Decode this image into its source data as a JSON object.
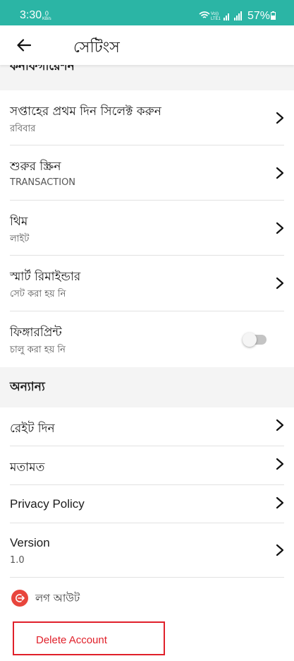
{
  "status_bar": {
    "time": "3:30",
    "data_rate_value": "0",
    "data_rate_unit": "KB/s",
    "network_label": "VoLTE1",
    "battery": "57%"
  },
  "app_bar": {
    "back_icon": "arrow-left-icon",
    "title": "সেটিংস"
  },
  "sections": {
    "config_title": "কনফিগারেশন",
    "other_title": "অন্যান্য"
  },
  "settings": {
    "week_start": {
      "title": "সপ্তাহের প্রথম দিন সিলেক্ট করুন",
      "value": "রবিবার"
    },
    "start_screen": {
      "title": "শুরুর স্ক্রিন",
      "value": "TRANSACTION"
    },
    "theme": {
      "title": "থিম",
      "value": "লাইট"
    },
    "smart_reminder": {
      "title": "স্মার্ট রিমাইন্ডার",
      "value": "সেট করা হয় নি"
    },
    "fingerprint": {
      "title": "ফিঙ্গারপ্রিন্ট",
      "value": "চালু করা হয় নি",
      "enabled": false
    }
  },
  "other": {
    "rate": {
      "title": "রেইট দিন"
    },
    "feedback": {
      "title": "মতামত"
    },
    "privacy": {
      "title": "Privacy Policy"
    },
    "version": {
      "title": "Version",
      "value": "1.0"
    }
  },
  "logout": {
    "label": "লগ আউট",
    "icon": "logout-icon"
  },
  "delete_account": {
    "label": "Delete Account"
  },
  "colors": {
    "status_bar": "#2bb5a5",
    "danger": "#e0202a",
    "logout_icon_bg": "#e8453c"
  }
}
